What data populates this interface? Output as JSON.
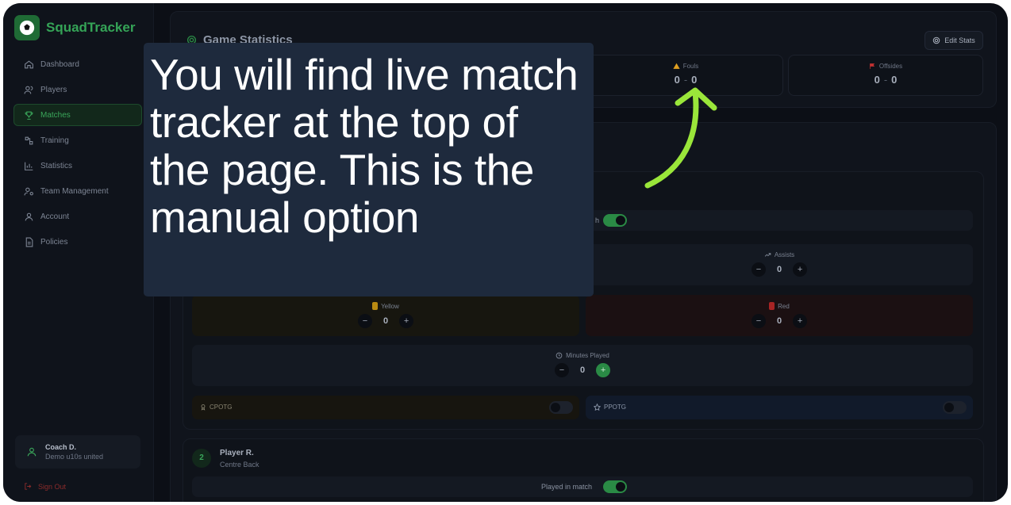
{
  "brand": {
    "name": "SquadTracker",
    "logo_icon": "soccer-ball-icon"
  },
  "nav": {
    "items": [
      {
        "label": "Dashboard",
        "icon": "home-icon",
        "active": false
      },
      {
        "label": "Players",
        "icon": "users-icon",
        "active": false
      },
      {
        "label": "Matches",
        "icon": "trophy-icon",
        "active": true
      },
      {
        "label": "Training",
        "icon": "training-icon",
        "active": false
      },
      {
        "label": "Statistics",
        "icon": "bar-chart-icon",
        "active": false
      },
      {
        "label": "Team Management",
        "icon": "team-settings-icon",
        "active": false
      },
      {
        "label": "Account",
        "icon": "user-icon",
        "active": false
      },
      {
        "label": "Policies",
        "icon": "document-icon",
        "active": false
      }
    ]
  },
  "user": {
    "name": "Coach D.",
    "team": "Demo u10s united"
  },
  "signout_label": "Sign Out",
  "game_stats": {
    "title": "Game Statistics",
    "edit_label": "Edit Stats",
    "fouls": {
      "label": "Fouls",
      "home": "0",
      "sep": "-",
      "away": "0"
    },
    "offsides": {
      "label": "Offsides",
      "home": "0",
      "sep": "-",
      "away": "0"
    }
  },
  "player1": {
    "played_suffix": "h",
    "assists": {
      "label": "Assists",
      "value": "0"
    },
    "yellow": {
      "label": "Yellow",
      "value": "0"
    },
    "red": {
      "label": "Red",
      "value": "0"
    },
    "minutes": {
      "label": "Minutes Played",
      "value": "0"
    },
    "cpotg_label": "CPOTG",
    "ppotg_label": "PPOTG"
  },
  "player2": {
    "number": "2",
    "name": "Player R.",
    "position": "Centre Back",
    "played_label": "Played in match"
  },
  "stepper": {
    "minus": "−",
    "plus": "+"
  },
  "overlay": {
    "text": "You will find live match tracker at the top of the page. This is the manual option"
  },
  "colors": {
    "accent": "#2a8a45",
    "overlay_bg": "#1e2a3d",
    "arrow": "#9ae63a",
    "danger": "#8c2b2b"
  }
}
